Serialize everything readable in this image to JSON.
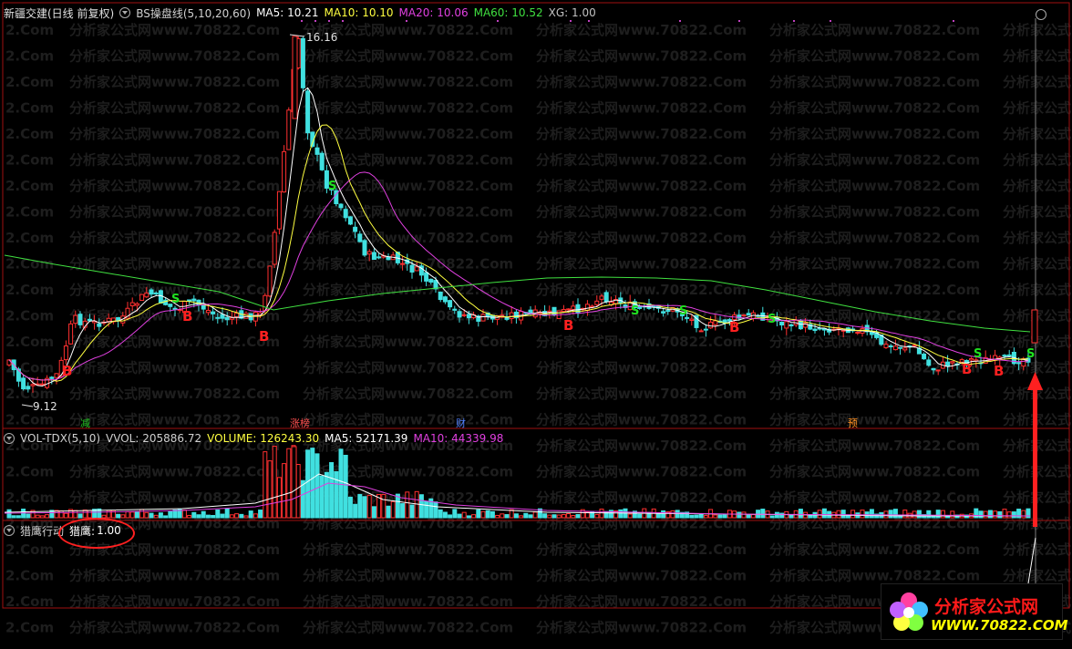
{
  "main_header": {
    "stock": "新疆交建(日线 前复权)",
    "indicator": "BS操盘线(5,10,20,60)",
    "ma5": "MA5: 10.21",
    "ma10": "MA10: 10.10",
    "ma20": "MA20: 10.06",
    "ma60": "MA60: 10.52",
    "xg": "XG: 1.00"
  },
  "price_labels": {
    "high": "16.16",
    "low": "9.12"
  },
  "signals": {
    "buy": "B",
    "sell": "S"
  },
  "events": [
    {
      "label": "减",
      "color": "#20c020"
    },
    {
      "label": "涨榜",
      "color": "#ff5050"
    },
    {
      "label": "财",
      "color": "#5080ff"
    },
    {
      "label": "预",
      "color": "#ff9020"
    }
  ],
  "vol_header": {
    "title": "VOL-TDX(5,10)",
    "vvol": "VVOL: 205886.72",
    "volume": "VOLUME: 126243.30",
    "ma5": "MA5: 52171.39",
    "ma10": "MA10: 44339.98"
  },
  "lower_header": {
    "title": "猎鹰行动",
    "value_label": "猎鹰:",
    "value": "1.00"
  },
  "watermark": {
    "site": "分析家公式网www.70822.Com",
    "left": "2.Com"
  },
  "logo": {
    "title": "分析家公式网",
    "url": "WWW.70822.COM"
  },
  "colors": {
    "up": "#ff3030",
    "down": "#40e0e0",
    "ma5": "#ffffff",
    "ma10": "#ffff40",
    "ma20": "#e040e0",
    "ma60": "#40e040",
    "separator": "#a01010"
  },
  "chart_data": {
    "type": "candlestick",
    "price_high": 16.16,
    "price_low": 9.12,
    "ma_values": {
      "MA5": 10.21,
      "MA10": 10.1,
      "MA20": 10.06,
      "MA60": 10.52
    },
    "volume_values": {
      "VVOL": 205886.72,
      "VOLUME": 126243.3,
      "MA5": 52171.39,
      "MA10": 44339.98
    }
  }
}
